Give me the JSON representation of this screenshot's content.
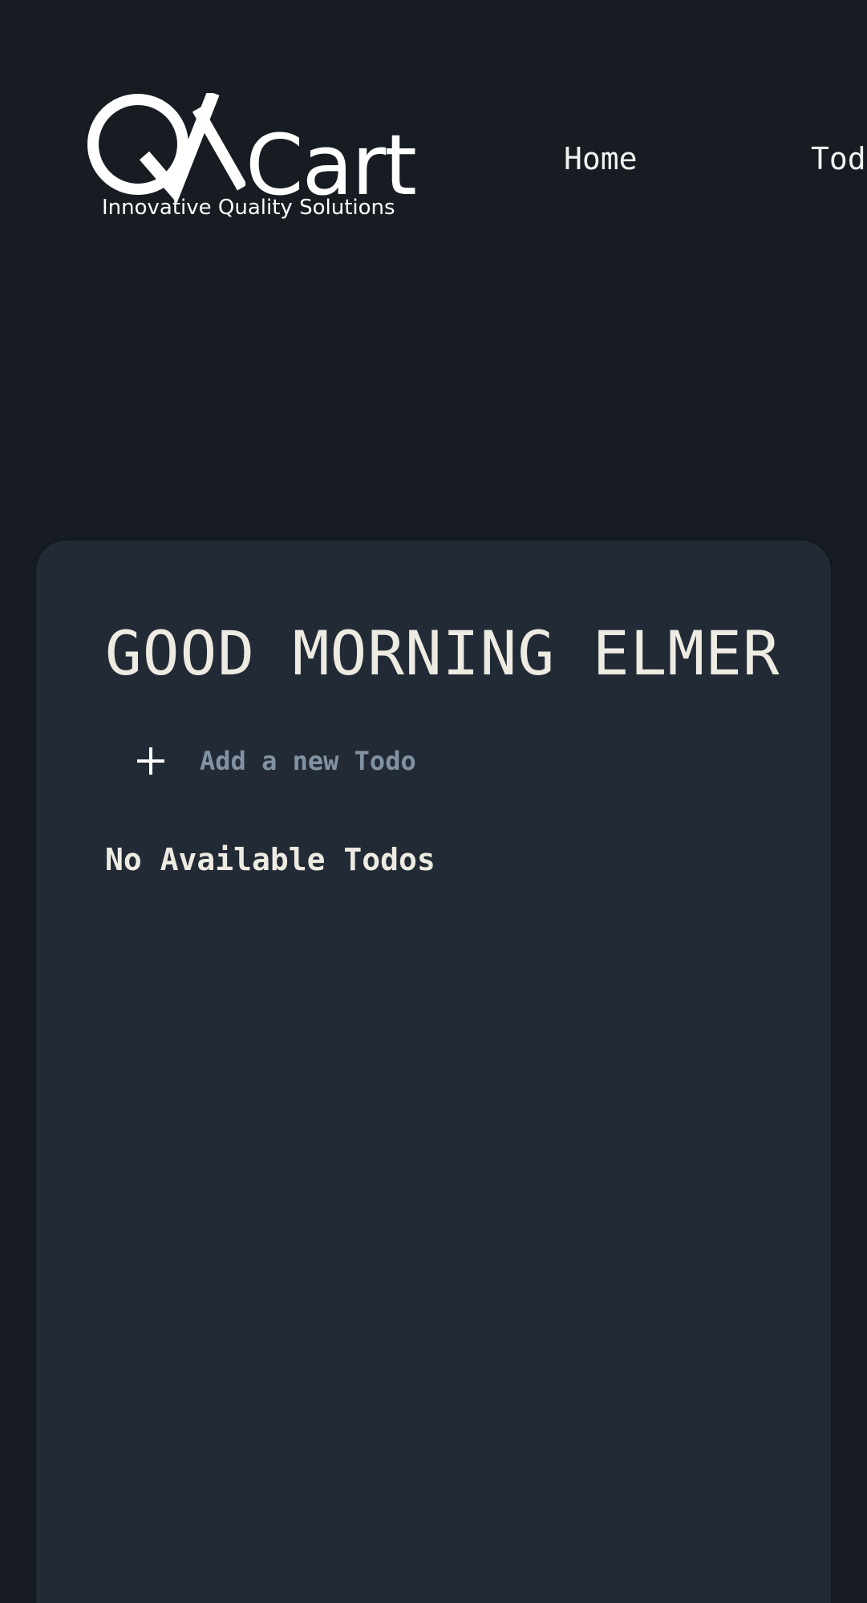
{
  "brand": {
    "wordmark": "Cart",
    "logo_lettering": "QA",
    "tagline": "Innovative Quality Solutions"
  },
  "nav": {
    "items": [
      {
        "label": "Home"
      },
      {
        "label": "Todos"
      }
    ]
  },
  "main": {
    "greeting": "GOOD MORNING ELMER",
    "add_todo": {
      "placeholder": "Add a new Todo",
      "value": "",
      "icon": "plus-icon"
    },
    "empty_message": "No Available Todos"
  },
  "colors": {
    "page_background": "#171c23",
    "card_background": "#222b35",
    "text_primary": "#eeebe3",
    "placeholder": "#8292a2"
  }
}
